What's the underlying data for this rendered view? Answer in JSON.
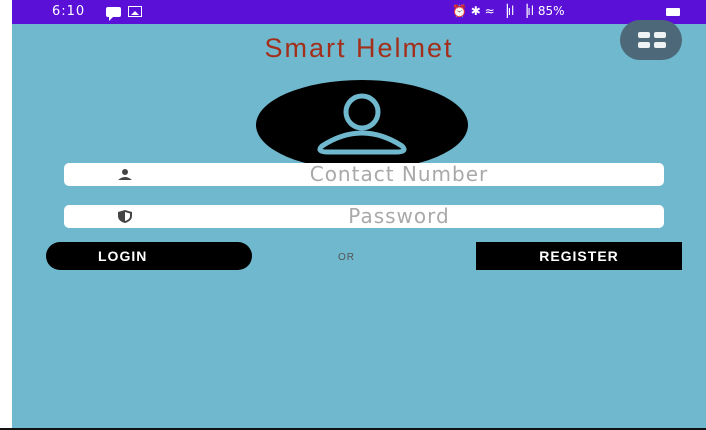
{
  "status_bar": {
    "time": "6:10",
    "right_text": "⏰ ✱ ≈ ▕ıl ▕ıl 85%"
  },
  "app": {
    "title": "Smart Helmet"
  },
  "form": {
    "contact_placeholder": "Contact Number",
    "password_placeholder": "Password",
    "login_label": "LOGIN",
    "or_label": "OR",
    "register_label": "REGISTER"
  },
  "icons": {
    "menu": "grid-menu-icon",
    "avatar": "user-avatar-icon",
    "contact": "person-icon",
    "password": "shield-icon"
  },
  "colors": {
    "background": "#6fb8cd",
    "status_bar": "#5b10d8",
    "title": "#a32f1a",
    "button": "#000000"
  }
}
